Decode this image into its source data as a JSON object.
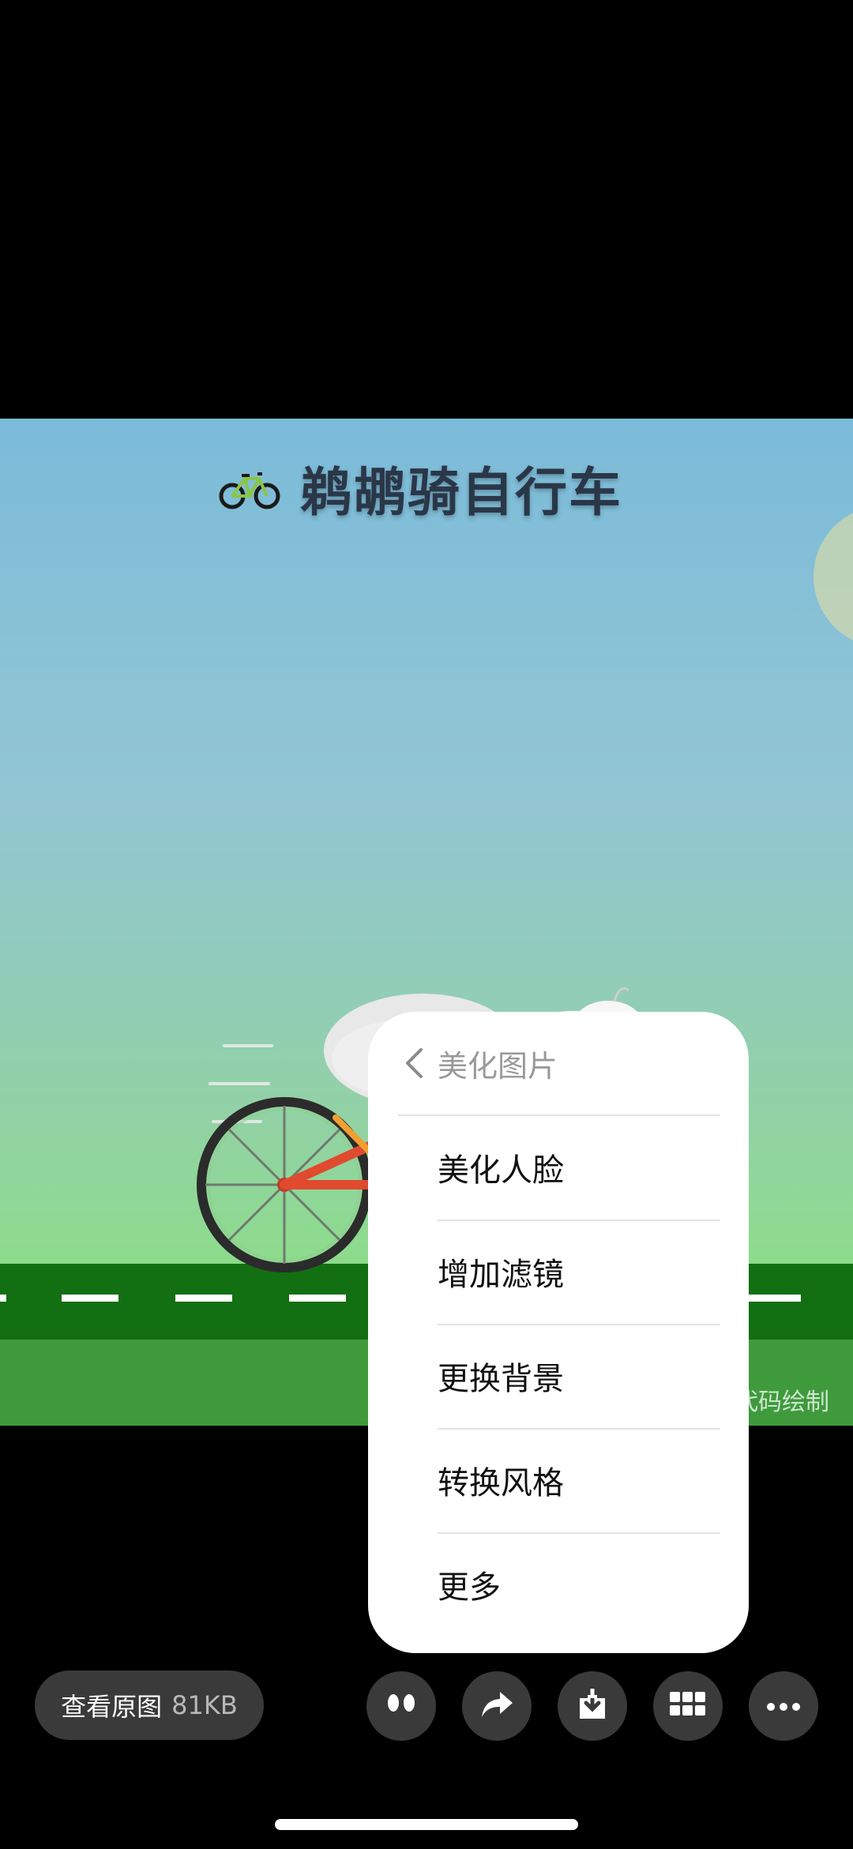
{
  "image": {
    "title": "鹈鹕骑自行车",
    "title_icon": "bicycle-icon",
    "watermark": "代码绘制"
  },
  "menu": {
    "header": {
      "label": "美化图片",
      "icon": "chevron-left-icon"
    },
    "items": [
      {
        "label": "美化人脸"
      },
      {
        "label": "增加滤镜"
      },
      {
        "label": "更换背景"
      },
      {
        "label": "转换风格"
      },
      {
        "label": "更多"
      }
    ]
  },
  "bottom_bar": {
    "view_original": {
      "label": "查看原图",
      "size": "81KB"
    },
    "buttons": [
      {
        "icon": "eyes-icon"
      },
      {
        "icon": "share-icon"
      },
      {
        "icon": "download-icon"
      },
      {
        "icon": "grid-icon"
      },
      {
        "icon": "more-icon"
      }
    ]
  },
  "colors": {
    "background": "#000000",
    "menu_bg": "#ffffff",
    "button_bg": "#3a3a3a",
    "sky_top": "#7bbbd9",
    "grass": "#1a7a1a"
  }
}
